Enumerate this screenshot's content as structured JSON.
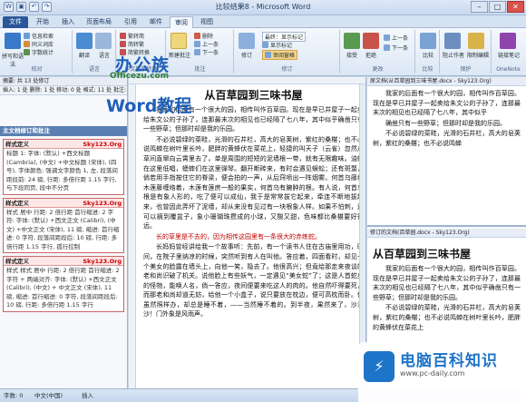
{
  "window": {
    "title": "比较结果8 - Microsoft Word"
  },
  "ribbon_tabs": [
    "文件",
    "开始",
    "插入",
    "页面布局",
    "引用",
    "邮件",
    "审阅",
    "视图"
  ],
  "active_tab": "审阅",
  "ribbon": {
    "groups": [
      "校对",
      "语言",
      "中文简繁转换",
      "批注",
      "修订",
      "更改",
      "比较",
      "保护",
      "OneNote"
    ],
    "spelling_label": "拼写和语法",
    "research_label": "信息检索",
    "thesaurus_label": "同义词库",
    "wordcount_label": "字数统计",
    "translate_label": "翻译",
    "language_label": "语言",
    "trad_label": "繁转简",
    "simp_label": "简转繁",
    "convert_label": "简繁转换",
    "new_comment_label": "新建批注",
    "delete_label": "删除",
    "prev_label": "上一条",
    "next_label": "下一条",
    "track_label": "修订",
    "final_label": "最终：显示标记",
    "show_markup_label": "显示标记",
    "review_pane_label": "审阅窗格",
    "accept_label": "接受",
    "reject_label": "拒绝",
    "prev2_label": "上一条",
    "next2_label": "下一条",
    "compare_label": "比较",
    "block_authors_label": "阻止作者",
    "restrict_label": "限制编辑",
    "onenote_label": "链接笔记"
  },
  "nav_pane": {
    "summary": "摘要: 共 13 处修订",
    "detail": "插入: 1 处  删除: 1 处  移动: 0 处  格式: 11 处  批注: 0 处",
    "section_title": "主文档修订和批注",
    "cards": [
      {
        "head": "样式定义",
        "author": "Sky123.Org",
        "body": "标题 1: 字体: (默认) +西文标题 (Cambria), (中文) +中文标题 (宋体), (四号), 字体颜色: 强调文字颜色 1, 左, 段落间距段前: 24 磅, 行距: 多倍行距 1.15 字行, 与下段同页, 段中不分页"
      },
      {
        "head": "样式定义",
        "author": "Sky123.Org",
        "body": "样式 居中 行距: 2 倍行距 首行缩进: 2 字符: 字体: (默认) +西文正文 (Calibri), (中文) +中文正文 (宋体), 11 磅, 缩进: 首行缩进: 0 字符, 段落间距段后: 10 磅, 行距: 多倍行距 1.15 字行, 孤行控制"
      },
      {
        "head": "样式定义",
        "author": "Sky123.Org",
        "body": "样式 样式 居中 行距: 2 倍行距 首行缩进: 2 字符 + 两端对齐: 字体: (默认) +西文正文 (Calibri), (中文) + 中文正文 (宋体), 11 磅, 缩进: 首行缩进: 0 字符, 段落间距段后: 10 磅, 行距: 多倍行距 1.15 字行"
      }
    ]
  },
  "watermark": {
    "brand_cn": "办公族",
    "domain": "Officezu.com",
    "course": "Word教程"
  },
  "document": {
    "title": "从百草园到三味书屋",
    "paragraphs": [
      "我家的后面有一个很大的园，相传叫作百草园。现在是早已并屋子一起卖给朱文公的子孙了，连那最末次的相见也已经隔了七八年，其中似乎确凿只有一些野草；但那时却是我的乐园。",
      "不必说碧绿的菜畦，光滑的石井栏，高大的皂荚树，紫红的桑椹；也不必说鸣蝉在树叶里长吟，肥胖的黄蜂伏在菜花上，轻捷的叫天子（云雀）忽然从草间直窜向云霄里去了。单是周围的短短的泥墙根一带，就有无限趣味。油蛉在这里低唱，蟋蟀们在这里弹琴。翻开断砖来，有时会遇见蜈蚣；还有斑蝥，倘若用手指按住它的脊梁，便会拍的一声，从后窍喷出一阵烟雾。何首乌藤和木莲藤缠络着，木莲有莲房一般的果实，何首乌有臃肿的根。有人说，何首乌根是有象人形的，吃了便可以成仙，我于是常常拔它起来，牵连不断地拔起来，也曾因此弄坏了泥墙，却从来没有见过有一块根象人样。如果不怕刺，还可以摘到覆盆子，象小珊瑚珠攒成的小球，又酸又甜，色味都比桑椹要好得远。",
      "长的草里是不去的，因为相传这园里有一条很大的赤练蛇。",
      "长妈妈曾经讲给我一个故事听：先前，有一个读书人住在古庙里用功，晚间，在院子里纳凉的时候，突然听到有人在叫他。答应着，四面看时，却见一个美女的脸露在墙头上，向他一笑，隐去了。他很高兴；但竟给那走来夜谈的老和尚识破了机关。说他脸上有些妖气，一定遇见“美女蛇”了；这是人首蛇身的怪物，能唤人名，倘一答应，夜间便要来吃这人的肉的。他自然吓得要死，而那老和尚却道无妨，给他一个小盒子，说只要放在枕边，便可高枕而卧。他虽然照样办，却总是睡不着，——当然睡不着的。到半夜，果然来了，沙沙沙！门外象是风雨声。"
    ]
  },
  "original_pane": {
    "header": "原文档(从百草园到三味书屋.docx - Sky123.Org)",
    "paragraphs": [
      "我家的后面有一个很大的园，相传叫作百草园。现在是早已并屋子一起卖给朱文公的子孙了，连那最末次的相见也已经隔了七八年，其中似乎",
      "确凿只有一些野草；但那时却是我的乐园。",
      "不必说碧绿的菜畦，光滑的石井栏，高大的皂荚树，紫红的桑椹；也不必说鸣蝉"
    ]
  },
  "revised_pane": {
    "header": "修订的文档(百草园.docx - Sky123.Org)",
    "title": "从百草园到三味书屋",
    "paragraphs": [
      "我家的后面有一个很大的园，相传叫作百草园。现在是早已并屋子一起卖给朱文公的子孙了，连那最末次的相见也已经隔了七八年，其中似乎确凿只有一些野草；但那时却是我的乐园。",
      "不必说碧绿的菜畦，光滑的石井栏，高大的皂荚树，紫红的桑椹；也不必说鸣蝉在树叶里长吟，肥胖的黄蜂伏在菜花上"
    ]
  },
  "statusbar": {
    "page": "字数: 0",
    "lang": "中文(中国)",
    "mode": "插入"
  },
  "brand": {
    "icon_text": "⚡",
    "name": "电脑百科知识",
    "url": "www.pc-daily.com"
  },
  "colors": {
    "accent": "#2b579a",
    "track_red": "#c00000",
    "brand_blue": "#1e74c8"
  }
}
